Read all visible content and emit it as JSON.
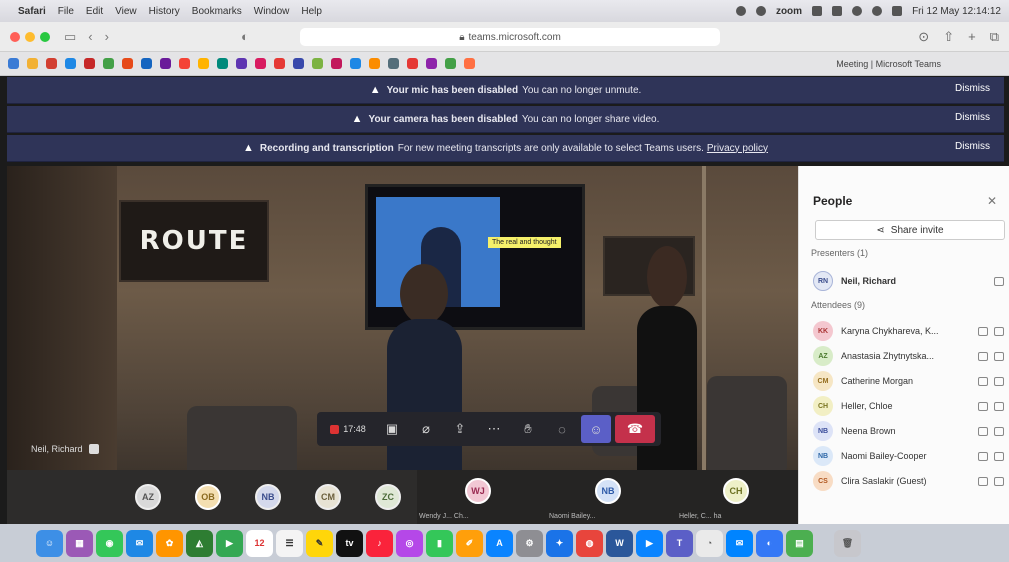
{
  "menubar": {
    "app": "Safari",
    "items": [
      "File",
      "Edit",
      "View",
      "History",
      "Bookmarks",
      "Window",
      "Help"
    ],
    "zoom_label": "zoom",
    "datetime": "Fri 12 May 12:14:12"
  },
  "browser": {
    "url": "teams.microsoft.com",
    "tab_title": "Meeting | Microsoft Teams"
  },
  "banners": [
    {
      "bold": "Your mic has been disabled",
      "text": "You can no longer unmute.",
      "link": "",
      "dismiss": "Dismiss"
    },
    {
      "bold": "Your camera has been disabled",
      "text": "You can no longer share video.",
      "link": "",
      "dismiss": "Dismiss"
    },
    {
      "bold": "Recording and transcription",
      "text": "For new meeting transcripts are only available to select Teams users.",
      "link": "Privacy policy",
      "dismiss": "Dismiss"
    }
  ],
  "stage": {
    "logo_text": "ROUTE",
    "screen_caption": "The real and thought",
    "speaker_name": "Neil, Richard"
  },
  "controls": {
    "timer": "17:48"
  },
  "strip": {
    "avatars": [
      "AZ",
      "OB",
      "NB",
      "CM",
      "ZC"
    ],
    "tiles": [
      {
        "initials": "WJ",
        "name": "Wendy J... Ch..."
      },
      {
        "initials": "NB",
        "name": "Naomi Bailey..."
      },
      {
        "initials": "CH",
        "name": "Heller, C... ha"
      }
    ]
  },
  "people": {
    "title": "People",
    "share_label": "Share invite",
    "presenters_label": "Presenters (1)",
    "attendees_label": "Attendees (9)",
    "presenters": [
      {
        "initials": "RN",
        "name": "Neil, Richard"
      }
    ],
    "attendees": [
      {
        "initials": "KK",
        "name": "Karyna Chykhareva, K...",
        "color": "#f4c7cf",
        "fg": "#a33"
      },
      {
        "initials": "AZ",
        "name": "Anastasia Zhytnytska...",
        "color": "#d8ecc8",
        "fg": "#4b7a2e"
      },
      {
        "initials": "CM",
        "name": "Catherine Morgan",
        "color": "#f6e6c4",
        "fg": "#946d1e"
      },
      {
        "initials": "CH",
        "name": "Heller, Chloe",
        "color": "#f2efc4",
        "fg": "#7a7420"
      },
      {
        "initials": "NB",
        "name": "Neena Brown",
        "color": "#dde3f7",
        "fg": "#3a4c9a"
      },
      {
        "initials": "NB",
        "name": "Naomi Bailey-Cooper",
        "color": "#dbe8f8",
        "fg": "#2d67a8"
      },
      {
        "initials": "CS",
        "name": "Clira Saslakir (Guest)",
        "color": "#f8dcc4",
        "fg": "#b0561e"
      }
    ]
  },
  "dock": {
    "calendar_day": "12",
    "tv_label": "tv"
  }
}
